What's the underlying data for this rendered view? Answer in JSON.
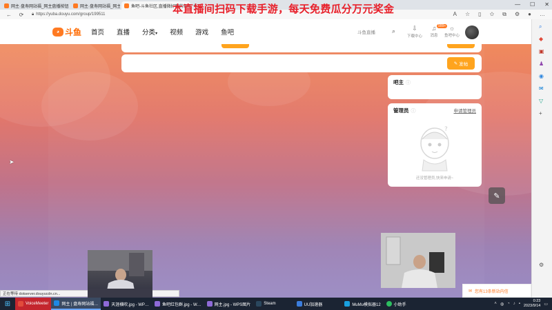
{
  "browser": {
    "tabs": [
      {
        "label": "网主·盘寿网站福_网主盘播按钮·斗鱼",
        "active": false
      },
      {
        "label": "网主·盘寿网站福_网主盘播按钮·斗鱼",
        "active": false
      },
      {
        "label": "鱼吧-斗鱼社区,直播微好聊的鱼吧",
        "active": true
      }
    ],
    "new_tab": "+",
    "window_controls": [
      "—",
      "☐",
      "✕"
    ],
    "url": "https://yuba.douyu.com/group/199511",
    "promo_banner": "本直播间扫码下载手游，每天免费瓜分万元奖金"
  },
  "site": {
    "logo_text": "斗鱼",
    "nav": [
      "首页",
      "直播",
      "分类",
      "视频",
      "游戏",
      "鱼吧"
    ],
    "search_placeholder": "斗鱼直播",
    "header_items": [
      {
        "label": "下载中心",
        "icon": "download-icon"
      },
      {
        "label": "消息",
        "icon": "bell-icon"
      },
      {
        "label": "鱼吧中心",
        "icon": "bulb-icon"
      }
    ],
    "message_badge": "999+"
  },
  "main": {
    "post_button_label": "发帖",
    "bar_owner_title": "吧主",
    "admins_title": "管理员",
    "apply_admin_label": "申请管理员",
    "empty_admins_text": "还没管理员,快来申请~"
  },
  "status_url": "正在等待 dotserver.douyucdn.cn...",
  "notification": "您有13条新站内信",
  "taskbar": {
    "items": [
      {
        "label": "VoiceMeeter",
        "color": "#e24b3b",
        "style": "red"
      },
      {
        "label": "网主 | 盘寿网站福…",
        "color": "#1e88e5",
        "style": "active"
      },
      {
        "label": "天涯横吹.jpg - WP…",
        "color": "#8e6ad8",
        "style": ""
      },
      {
        "label": "鱼吧红包群.jpg - W…",
        "color": "#8e6ad8",
        "style": ""
      },
      {
        "label": "网主.jpg - WPS图片",
        "color": "#8e6ad8",
        "style": ""
      },
      {
        "label": "Steam",
        "color": "#2a475e",
        "style": ""
      },
      {
        "label": "UU加速器",
        "color": "#3b7ddd",
        "style": ""
      },
      {
        "label": "MuMu模拟器12",
        "color": "#19a0e0",
        "style": ""
      },
      {
        "label": "小助手",
        "color": "#2dbe60",
        "style": ""
      }
    ],
    "time": "0:23",
    "date": "2023/9/14"
  },
  "colors": {
    "accent": "#ff7a22",
    "button": "#ffa41e",
    "promo": "#e8202a"
  }
}
